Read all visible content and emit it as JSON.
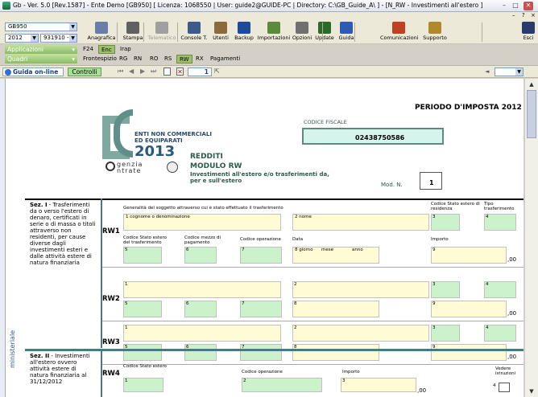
{
  "window": {
    "title": "Gb - Ver. 5.0 [Rev.1587] - Ente Demo [GB950]    [ Licenza: 1068550 | User: guide2@GUIDE-PC | Directory: C:\\GB_Guide_A\\ ] - [N_RW - Investimenti all'estero ]"
  },
  "selectors": {
    "company": "GB950",
    "year": "2012",
    "code": "931910 -"
  },
  "toolbar": {
    "buttons": [
      {
        "label": "Anagrafica",
        "enabled": true,
        "color": "#6a7ca8"
      },
      {
        "label": "Stampa",
        "enabled": true,
        "color": "#606060"
      },
      {
        "label": "Telematico",
        "enabled": false,
        "color": "#a0a0a0"
      },
      {
        "label": "Console T.",
        "enabled": true,
        "color": "#3c5a8a"
      },
      {
        "label": "Utenti",
        "enabled": true,
        "color": "#8a6a3a"
      },
      {
        "label": "Backup",
        "enabled": true,
        "color": "#1c4a9c"
      },
      {
        "label": "Importazioni",
        "enabled": true,
        "color": "#5a8a3a"
      },
      {
        "label": "Opzioni",
        "enabled": true,
        "color": "#707070"
      },
      {
        "label": "Update",
        "enabled": true,
        "color": "#2a6a2a"
      },
      {
        "label": "Guida",
        "enabled": true,
        "color": "#2c5ab4"
      },
      {
        "label": "Comunicazioni",
        "enabled": true,
        "color": "#c04020"
      },
      {
        "label": "Supporto",
        "enabled": true,
        "color": "#b08a2a"
      },
      {
        "label": "Esci",
        "enabled": true,
        "color": "#2a3a6a"
      }
    ]
  },
  "sections": {
    "applicazioni": "Applicazioni",
    "quadri": "Quadri"
  },
  "tabs_top": [
    "F24",
    "Enc",
    "Irap"
  ],
  "tabs_bottom": [
    "Frontespizio",
    "RG",
    "RN",
    "RO",
    "RS",
    "RW",
    "RX",
    "Pagamenti"
  ],
  "nav": {
    "guida": "Guida on-line",
    "controlli": "Controlli",
    "page": "1"
  },
  "form": {
    "header": {
      "title": "PERIODO D'IMPOSTA 2012",
      "codice_fiscale_label": "CODICE FISCALE",
      "codice_fiscale": "02438750586",
      "mod_label": "Mod. N.",
      "mod_value": "1"
    },
    "logo": {
      "line1": "ENTI NON COMMERCIALI",
      "line2": "ED EQUIPARATI",
      "year": "2013",
      "agenzia": "genzia",
      "entrate": "ntrate",
      "vertical": "ministeriale"
    },
    "modulo": {
      "redditi": "REDDITI",
      "modulo": "MODULO RW",
      "desc": "Investimenti all'estero e/o trasferimenti da, per e sull'estero"
    },
    "sec1": {
      "label": "Sez. I",
      "text": " - Trasferimenti da o verso l'estero di denaro, certificati in serie o di massa o titoli attraverso non residenti, per cause diverse dagli investimenti esteri e dalle attività estere di natura finanziaria"
    },
    "sec2": {
      "label": "Sez. II",
      "text": " - Investimenti all'estero ovvero attività estere di natura finanziaria al 31/12/2012"
    },
    "labels": {
      "generalita": "Generalità del soggetto attraverso cui è stato effettuato il trasferimento",
      "codice_stato_residenza": "Codice Stato estero di residenza",
      "tipo_trasferimento": "Tipo trasferimento",
      "cognome": "1 cognome o denominazione",
      "nome": "2 nome",
      "codice_stato_trasf": "Codice Stato estero del trasferimento",
      "codice_mezzo": "Codice mezzo di pagamento",
      "codice_operazione": "Codice operazione",
      "data": "Data",
      "importo": "Importo",
      "giorno": "8 giorno",
      "mese": "mese",
      "anno": "anno",
      "codice_stato_estero": "Codice Stato estero",
      "vedere_istruzioni": "Vedere istruzioni",
      "zeros": ",00"
    },
    "rows": [
      "RW1",
      "RW2",
      "RW3",
      "RW4"
    ]
  }
}
